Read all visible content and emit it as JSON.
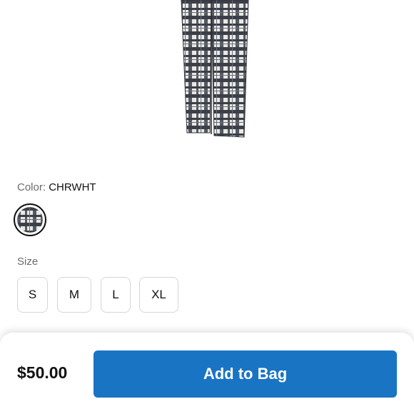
{
  "product": {
    "image_alt": "plaid pants",
    "colors": {
      "plaid_dark": "#3b3f4a",
      "plaid_light": "#e8e8e3"
    }
  },
  "color": {
    "label": "Color:",
    "value": "CHRWHT"
  },
  "size": {
    "label": "Size",
    "options": [
      "S",
      "M",
      "L",
      "XL"
    ]
  },
  "bottom_bar": {
    "price": "$50.00",
    "add_to_bag": "Add to Bag",
    "accent": "#1a74c4"
  }
}
